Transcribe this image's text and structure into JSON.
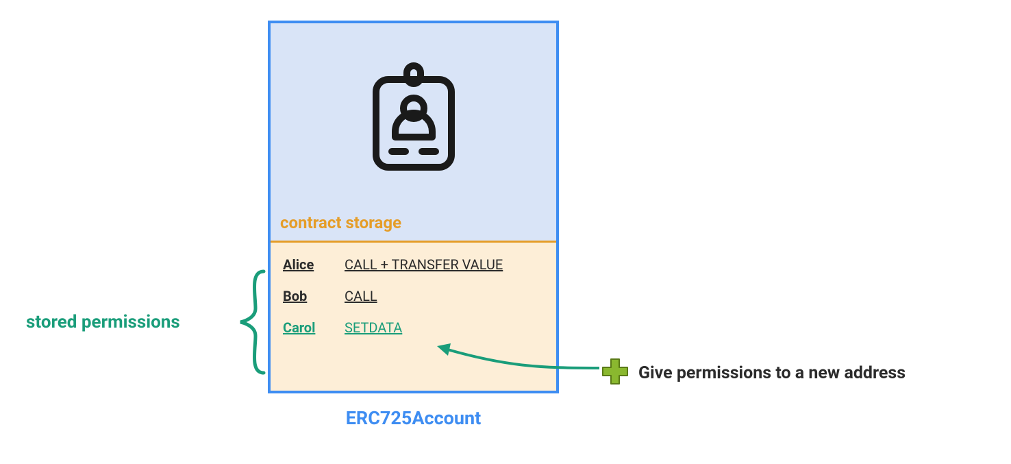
{
  "account": {
    "storage_label": "contract storage",
    "title": "ERC725Account",
    "permissions": [
      {
        "name": "Alice",
        "value": "CALL + TRANSFER VALUE",
        "new": false
      },
      {
        "name": "Bob",
        "value": "CALL",
        "new": false
      },
      {
        "name": "Carol",
        "value": "SETDATA",
        "new": true
      }
    ]
  },
  "annotations": {
    "stored_permissions": "stored permissions",
    "give_permissions": "Give permissions to a new address"
  },
  "colors": {
    "blue": "#3e8df2",
    "orange": "#e59d28",
    "teal": "#1a9d7a",
    "green_plus": "#75a221"
  }
}
